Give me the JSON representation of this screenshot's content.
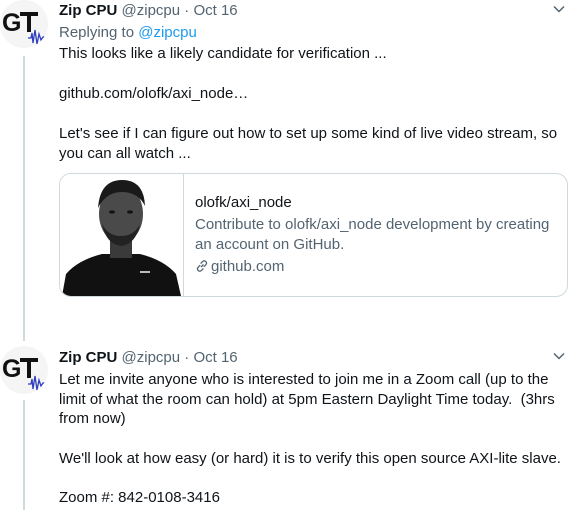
{
  "tweets": [
    {
      "author_name": "Zip CPU",
      "handle": "@zipcpu",
      "separator": "·",
      "date": "Oct 16",
      "reply_prefix": "Replying to",
      "reply_handle": "@zipcpu",
      "lines": [
        "This looks like a likely candidate for verification ...",
        "github.com/olofk/axi_node…",
        "Let's see if I can figure out how to set up some kind of live video stream, so",
        "you can all watch ..."
      ],
      "card": {
        "title": "olofk/axi_node",
        "description": "Contribute to olofk/axi_node development by creating an account on GitHub.",
        "domain": "github.com"
      }
    },
    {
      "author_name": "Zip CPU",
      "handle": "@zipcpu",
      "separator": "·",
      "date": "Oct 16",
      "lines": [
        "Let me invite anyone who is interested to join me in a Zoom call (up to the",
        "limit of what the room can hold) at 5pm Eastern Daylight Time today.  (3hrs",
        "from now)",
        "We'll look at how easy (or hard) it is to verify this open source AXI-lite slave.",
        "Zoom #: 842-0108-3416"
      ]
    }
  ],
  "colors": {
    "text": "#0f1419",
    "muted": "#536471",
    "link": "#1d9bf0",
    "border": "#cfd9de",
    "logo_wave": "#2f3fbf"
  },
  "icons": [
    "zipcpu-logo-avatar",
    "chevron-down-icon",
    "link-icon"
  ]
}
